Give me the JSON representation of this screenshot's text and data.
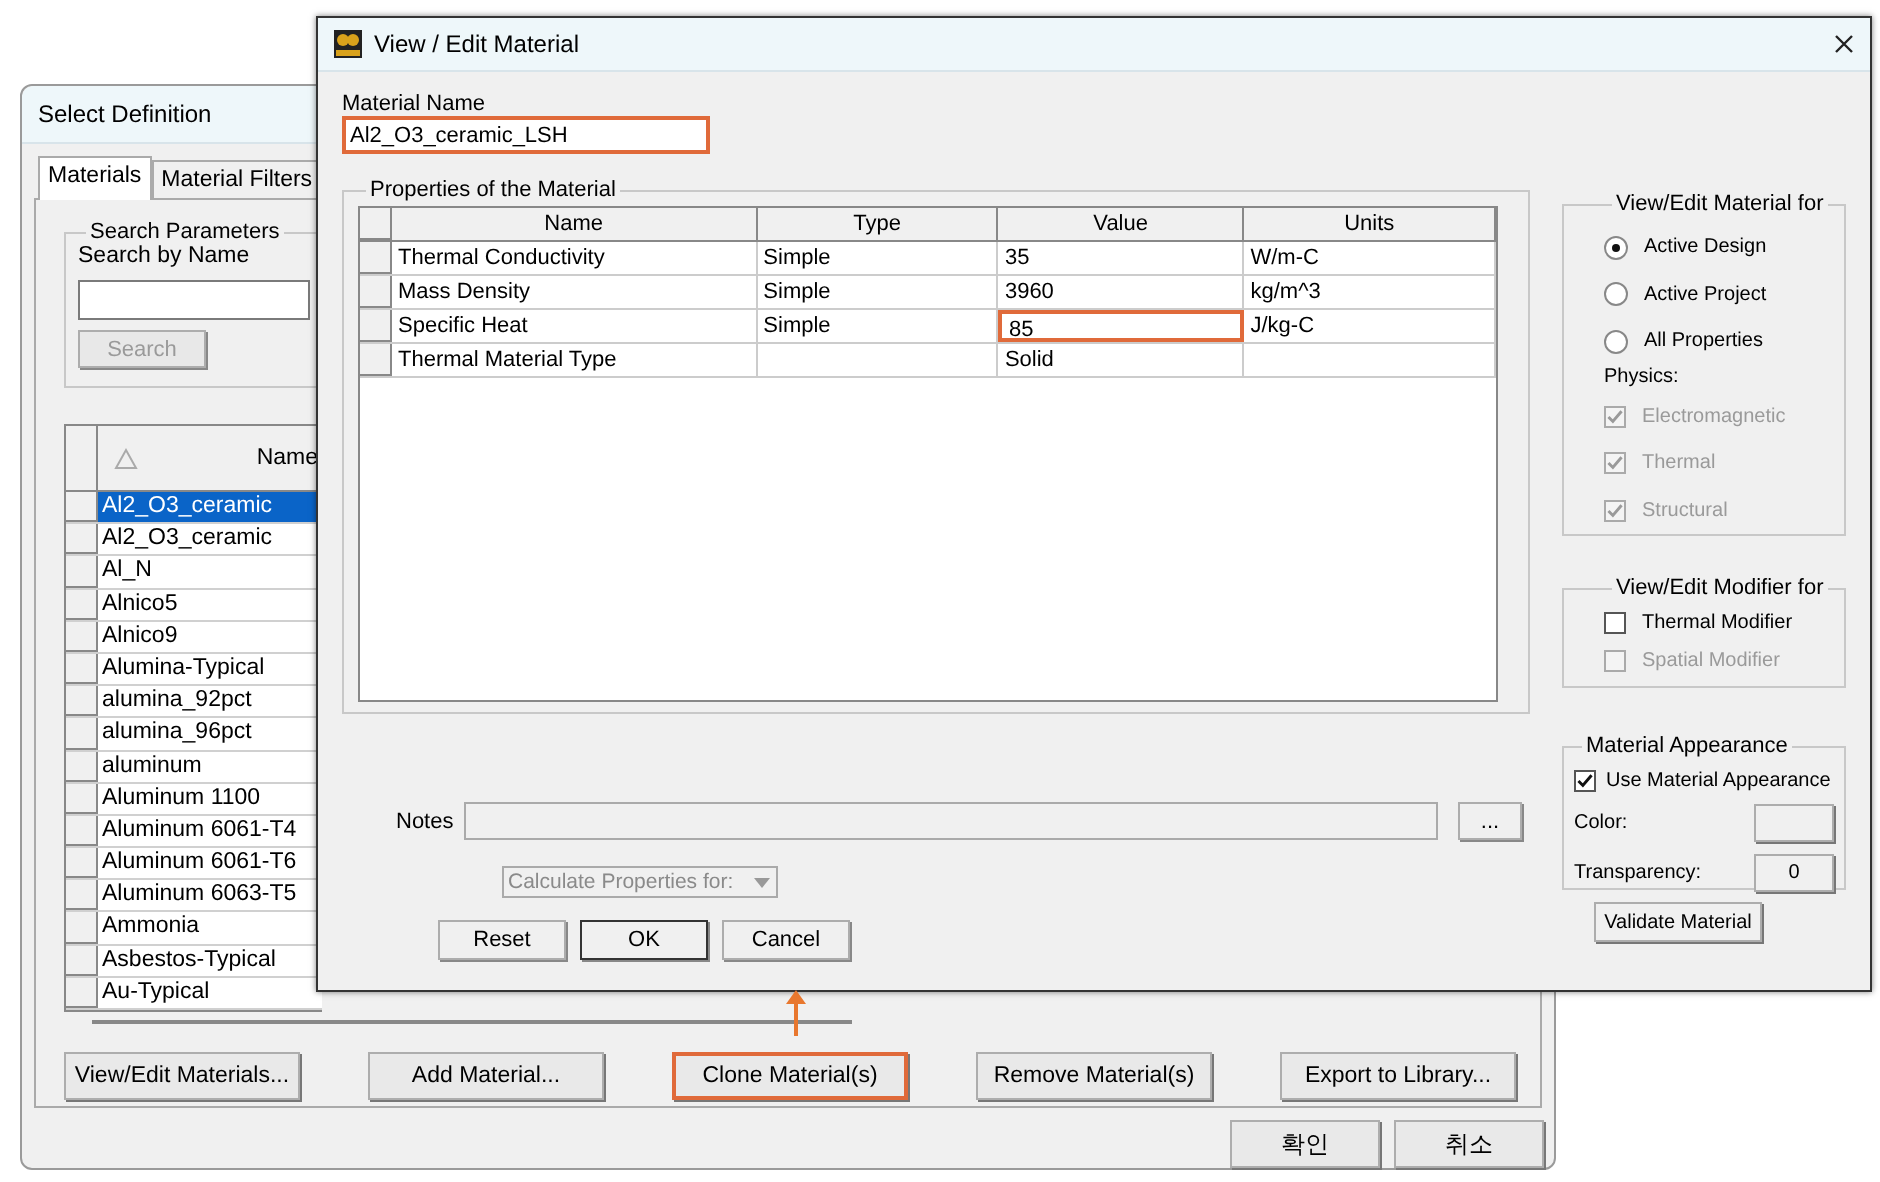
{
  "select_definition": {
    "title": "Select Definition",
    "tabs": [
      {
        "label": "Materials",
        "selected": true
      },
      {
        "label": "Material Filters",
        "selected": false
      }
    ],
    "search": {
      "group_title": "Search Parameters",
      "label": "Search by Name",
      "button": "Search",
      "button_disabled": true
    },
    "materials_table": {
      "columns": [
        "Name"
      ],
      "rows": [
        {
          "name": "Al2_O3_ceramic",
          "selected": true
        },
        {
          "name": "Al2_O3_ceramic",
          "selected": false
        },
        {
          "name": "Al_N",
          "selected": false
        },
        {
          "name": "Alnico5",
          "selected": false
        },
        {
          "name": "Alnico9",
          "selected": false
        },
        {
          "name": "Alumina-Typical",
          "selected": false
        },
        {
          "name": "alumina_92pct",
          "selected": false
        },
        {
          "name": "alumina_96pct",
          "selected": false
        },
        {
          "name": "aluminum",
          "selected": false
        },
        {
          "name": "Aluminum 1100",
          "selected": false
        },
        {
          "name": "Aluminum 6061-T4",
          "selected": false
        },
        {
          "name": "Aluminum 6061-T6",
          "selected": false
        },
        {
          "name": "Aluminum 6063-T5",
          "selected": false
        },
        {
          "name": "Ammonia",
          "selected": false
        },
        {
          "name": "Asbestos-Typical",
          "selected": false
        },
        {
          "name": "Au-Typical",
          "selected": false
        }
      ]
    },
    "buttons": [
      {
        "label": "View/Edit Materials...",
        "highlighted": false
      },
      {
        "label": "Add Material...",
        "highlighted": false
      },
      {
        "label": "Clone Material(s)",
        "highlighted": true
      },
      {
        "label": "Remove Material(s)",
        "highlighted": false
      },
      {
        "label": "Export to Library...",
        "highlighted": false
      }
    ],
    "dialog_buttons": [
      "확인",
      "취소"
    ]
  },
  "view_edit_material": {
    "title": "View / Edit Material",
    "material_name": {
      "label": "Material Name",
      "value": "Al2_O3_ceramic_LSH",
      "highlighted": true
    },
    "properties": {
      "group_title": "Properties of the Material",
      "columns": [
        "Name",
        "Type",
        "Value",
        "Units"
      ],
      "rows": [
        {
          "cells": [
            "Thermal Conductivity",
            "Simple",
            "35",
            "W/m-C"
          ],
          "value_highlighted": false
        },
        {
          "cells": [
            "Mass Density",
            "Simple",
            "3960",
            "kg/m^3"
          ],
          "value_highlighted": false
        },
        {
          "cells": [
            "Specific Heat",
            "Simple",
            "85",
            "J/kg-C"
          ],
          "value_highlighted": true
        },
        {
          "cells": [
            "Thermal Material Type",
            "",
            "Solid",
            ""
          ],
          "value_highlighted": false
        }
      ]
    },
    "notes": {
      "label": "Notes",
      "button": "..."
    },
    "calculate_dropdown": {
      "value": "Calculate Properties for:",
      "disabled": true
    },
    "buttons": [
      {
        "label": "Reset",
        "default": false
      },
      {
        "label": "OK",
        "default": true
      },
      {
        "label": "Cancel",
        "default": false
      }
    ],
    "view_edit_for": {
      "title": "View/Edit Material for",
      "options": [
        {
          "label": "Active Design",
          "selected": true
        },
        {
          "label": "Active Project",
          "selected": false
        },
        {
          "label": "All Properties",
          "selected": false
        }
      ],
      "physics_label": "Physics:",
      "physics": [
        {
          "label": "Electromagnetic",
          "checked": true,
          "disabled": true
        },
        {
          "label": "Thermal",
          "checked": true,
          "disabled": true
        },
        {
          "label": "Structural",
          "checked": true,
          "disabled": true
        }
      ]
    },
    "modifier_for": {
      "title": "View/Edit Modifier for",
      "options": [
        {
          "label": "Thermal Modifier",
          "checked": false,
          "disabled": false
        },
        {
          "label": "Spatial Modifier",
          "checked": false,
          "disabled": true
        }
      ]
    },
    "appearance": {
      "title": "Material Appearance",
      "use_appearance": {
        "label": "Use Material Appearance",
        "checked": true
      },
      "color_label": "Color:",
      "transparency_label": "Transparency:",
      "transparency": "0"
    },
    "validate_button": "Validate Material"
  }
}
